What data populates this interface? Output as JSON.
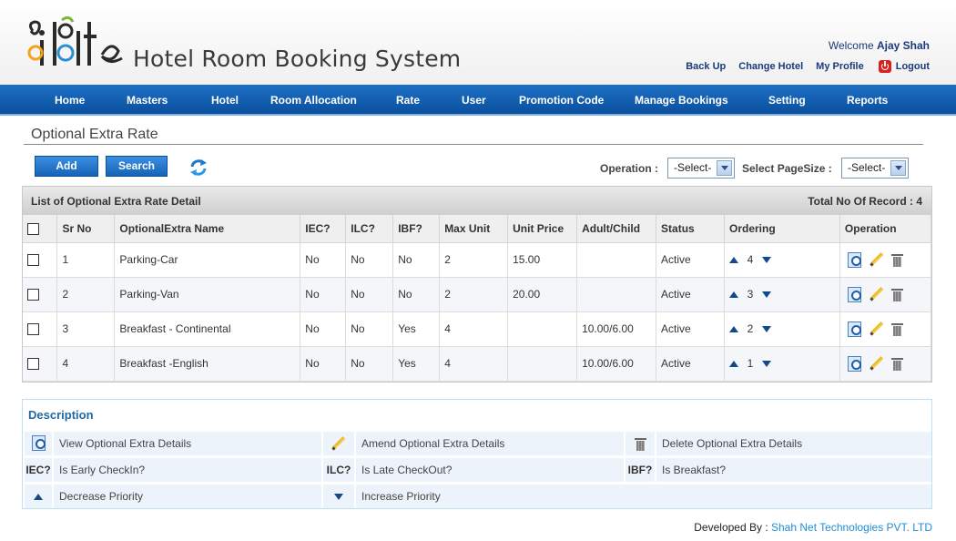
{
  "header": {
    "logo_text": "iolite",
    "app_title": "Hotel Room Booking System",
    "welcome_prefix": "Welcome",
    "user_name": "Ajay Shah",
    "links": {
      "back_up": "Back Up",
      "change_hotel": "Change Hotel",
      "my_profile": "My Profile",
      "logout": "Logout"
    }
  },
  "nav": [
    "Home",
    "Masters",
    "Hotel",
    "Room Allocation",
    "Rate",
    "User",
    "Promotion Code",
    "Manage Bookings",
    "Setting",
    "Reports"
  ],
  "page": {
    "title": "Optional Extra Rate",
    "add_label": "Add",
    "search_label": "Search",
    "operation_label": "Operation :",
    "operation_value": "-Select-",
    "pagesize_label": "Select PageSize :",
    "pagesize_value": "-Select-"
  },
  "grid": {
    "caption": "List of Optional Extra Rate Detail",
    "total_label": "Total No Of Record : 4",
    "columns": [
      "Sr No",
      "OptionalExtra Name",
      "IEC?",
      "ILC?",
      "IBF?",
      "Max Unit",
      "Unit Price",
      "Adult/Child",
      "Status",
      "Ordering",
      "Operation"
    ],
    "rows": [
      {
        "sr": "1",
        "name": "Parking-Car",
        "iec": "No",
        "ilc": "No",
        "ibf": "No",
        "max_unit": "2",
        "unit_price": "15.00",
        "adult_child": "",
        "status": "Active",
        "order": "4"
      },
      {
        "sr": "2",
        "name": "Parking-Van",
        "iec": "No",
        "ilc": "No",
        "ibf": "No",
        "max_unit": "2",
        "unit_price": "20.00",
        "adult_child": "",
        "status": "Active",
        "order": "3"
      },
      {
        "sr": "3",
        "name": "Breakfast - Continental",
        "iec": "No",
        "ilc": "No",
        "ibf": "Yes",
        "max_unit": "4",
        "unit_price": "",
        "adult_child": "10.00/6.00",
        "status": "Active",
        "order": "2"
      },
      {
        "sr": "4",
        "name": "Breakfast -English",
        "iec": "No",
        "ilc": "No",
        "ibf": "Yes",
        "max_unit": "4",
        "unit_price": "",
        "adult_child": "10.00/6.00",
        "status": "Active",
        "order": "1"
      }
    ]
  },
  "description": {
    "title": "Description",
    "view": "View Optional Extra Details",
    "amend": "Amend Optional Extra Details",
    "delete": "Delete Optional Extra Details",
    "iec_key": "IEC?",
    "iec": "Is Early CheckIn?",
    "ilc_key": "ILC?",
    "ilc": "Is Late CheckOut?",
    "ibf_key": "IBF?",
    "ibf": "Is Breakfast?",
    "decrease": "Decrease Priority",
    "increase": "Increase Priority"
  },
  "footer": {
    "prefix": "Developed By :",
    "company": "Shah Net Technologies PVT. LTD"
  },
  "colors": {
    "nav": "#0a4f9e",
    "accent": "#1f6aa5",
    "link": "#1b3a7a"
  }
}
